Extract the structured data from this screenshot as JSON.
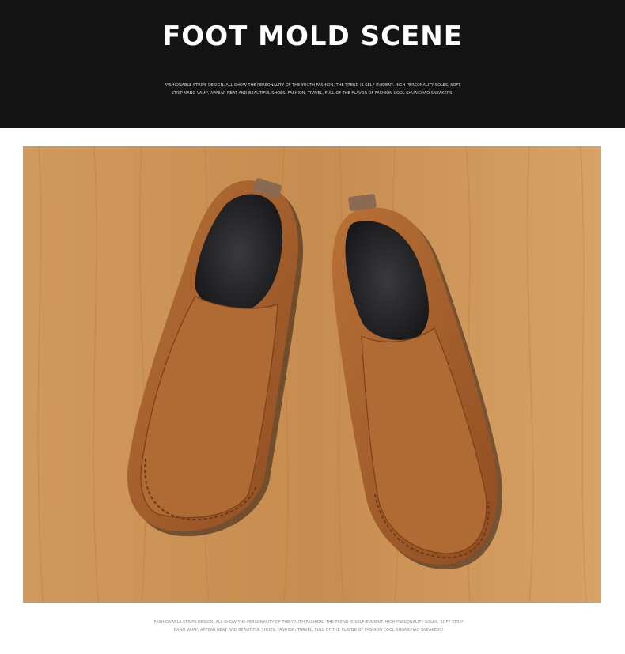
{
  "banner": {
    "title": "FOOT MOLD SCENE",
    "description": "FASHIONABLE STRIPE DESIGN, ALL SHOW THE PERSONALITY OF THE YOUTH FASHION, THE TREND IS SELF-EVIDENT. HIGH PERSONALITY SOLES, SOFT STRIP NANO VAMP, APPEAR NEAT AND BEAUTIFUL SHOES, FASHION, TRAVEL, FULL OF THE FLAVOR OF FASHION COOL SHUAICHAO SNEAKERS!"
  },
  "photo": {
    "subject": "pair of brown leather slip-on loafers on wooden floor",
    "colors": {
      "wood": "#c98f52",
      "leather": "#a8602c",
      "insole": "#232326"
    }
  },
  "footer": {
    "description": "FASHIONABLE STRIPE DESIGN, ALL SHOW THE PERSONALITY OF THE YOUTH FASHION, THE TREND IS SELF-EVIDENT. HIGH PERSONALITY SOLES, SOFT STRIP NANO VAMP, APPEAR NEAT AND BEAUTIFUL SHOES, FASHION, TRAVEL, FULL OF THE FLAVOR OF FASHION COOL SHUAICHAO SNEAKERS!"
  }
}
